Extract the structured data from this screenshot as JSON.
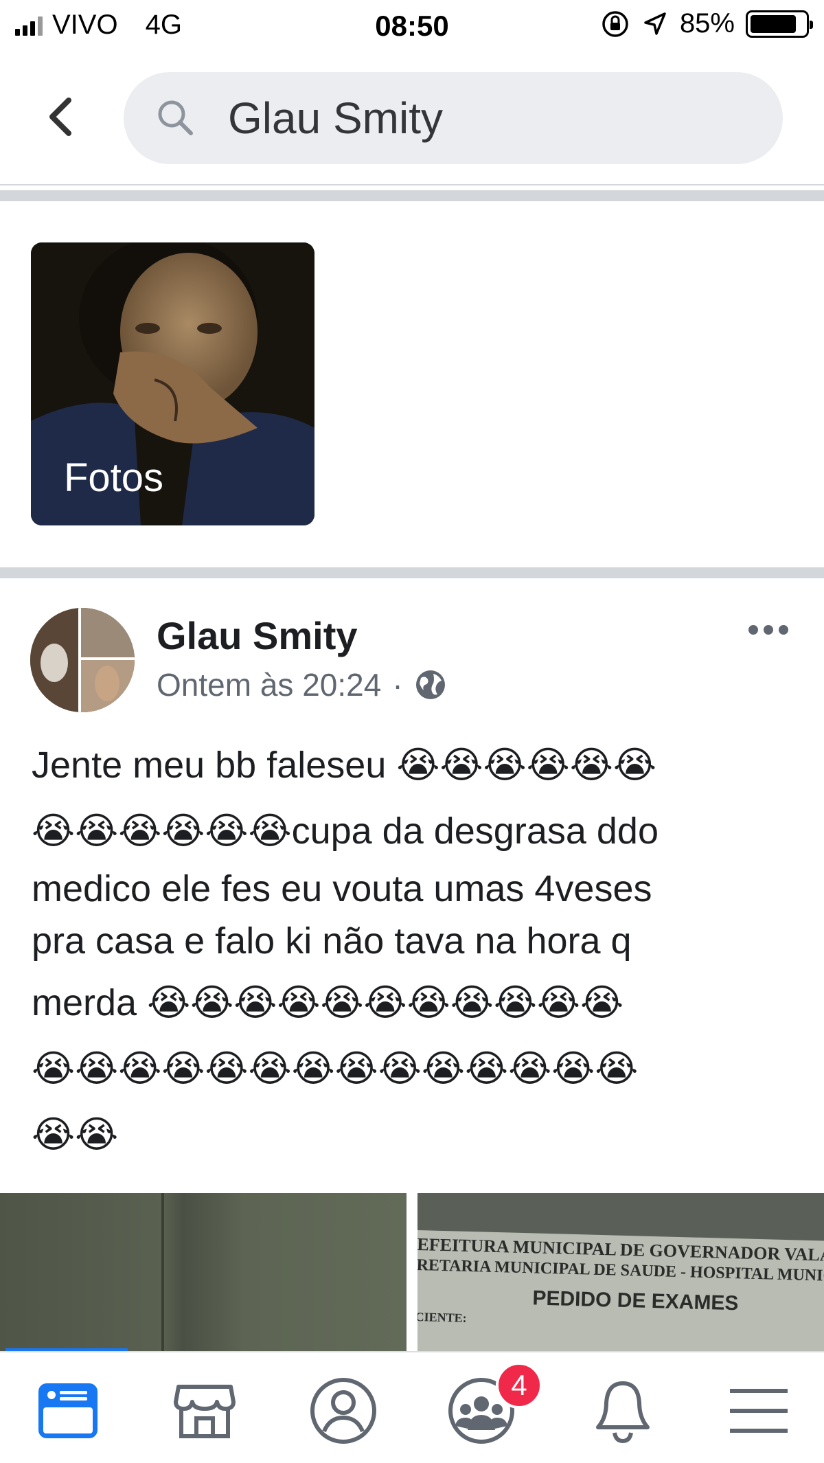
{
  "status_bar": {
    "carrier": "VIVO",
    "network": "4G",
    "time": "08:50",
    "battery": "85%",
    "battery_level": 0.85
  },
  "search": {
    "query": "Glau Smity"
  },
  "photos_tile": {
    "label": "Fotos"
  },
  "post": {
    "author": "Glau Smity",
    "timestamp": "Ontem às 20:24",
    "separator": "·",
    "privacy_icon": "globe-icon",
    "text_line1": "Jente meu bb faleseu 😭😭😭😭😭😭",
    "text_line2": "😭😭😭😭😭😭cupa da desgrasa ddo",
    "text_line3": "medico ele fes eu vouta umas 4veses",
    "text_line4": "pra casa e falo ki não tava na hora q",
    "text_line5": "merda 😭😭😭😭😭😭😭😭😭😭😭",
    "text_line6": "😭😭😭😭😭😭😭😭😭😭😭😭😭😭",
    "text_line7": "😭😭",
    "image_right_text": {
      "line1": "EFEITURA MUNICIPAL DE GOVERNADOR VALADARES",
      "line2": "RETARIA MUNICIPAL DE SAUDE - HOSPITAL MUNICIPAL",
      "line3": "PEDIDO DE EXAMES",
      "line4": "CIENTE:"
    }
  },
  "bottom_nav": {
    "items": [
      "news-feed-icon",
      "marketplace-icon",
      "profile-icon",
      "groups-icon",
      "notifications-icon",
      "menu-icon"
    ],
    "groups_badge": "4",
    "active": "news-feed-icon"
  },
  "colors": {
    "accent": "#1877f2",
    "badge": "#f02849",
    "search_bg": "#ebedf0",
    "divider": "#d3d6db"
  }
}
